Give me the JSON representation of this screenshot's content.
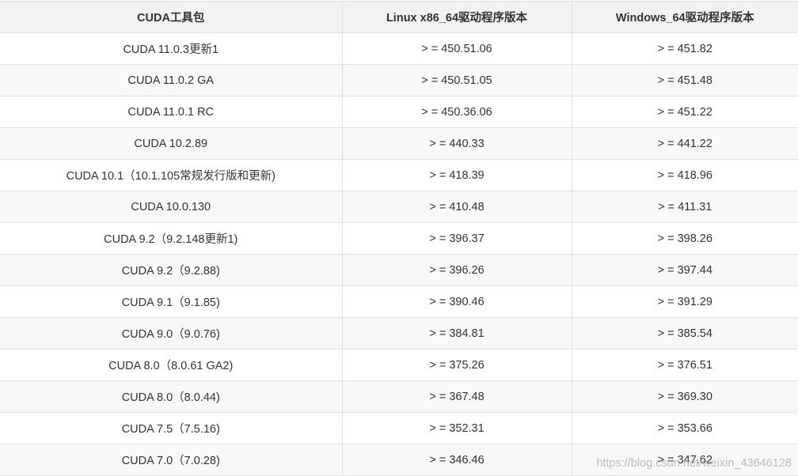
{
  "table": {
    "headers": [
      "CUDA工具包",
      "Linux x86_64驱动程序版本",
      "Windows_64驱动程序版本"
    ],
    "rows": [
      [
        "CUDA 11.0.3更新1",
        "> = 450.51.06",
        "> = 451.82"
      ],
      [
        "CUDA 11.0.2 GA",
        "> = 450.51.05",
        "> = 451.48"
      ],
      [
        "CUDA 11.0.1 RC",
        "> = 450.36.06",
        "> = 451.22"
      ],
      [
        "CUDA 10.2.89",
        "> = 440.33",
        "> = 441.22"
      ],
      [
        "CUDA 10.1（10.1.105常规发行版和更新)",
        "> = 418.39",
        "> = 418.96"
      ],
      [
        "CUDA 10.0.130",
        "> = 410.48",
        "> = 411.31"
      ],
      [
        "CUDA 9.2（9.2.148更新1)",
        "> = 396.37",
        "> = 398.26"
      ],
      [
        "CUDA 9.2（9.2.88)",
        "> = 396.26",
        "> = 397.44"
      ],
      [
        "CUDA 9.1（9.1.85)",
        "> = 390.46",
        "> = 391.29"
      ],
      [
        "CUDA 9.0（9.0.76)",
        "> = 384.81",
        "> = 385.54"
      ],
      [
        "CUDA 8.0（8.0.61 GA2)",
        "> = 375.26",
        "> = 376.51"
      ],
      [
        "CUDA 8.0（8.0.44)",
        "> = 367.48",
        "> = 369.30"
      ],
      [
        "CUDA 7.5（7.5.16)",
        "> = 352.31",
        "> = 353.66"
      ],
      [
        "CUDA 7.0（7.0.28)",
        "> = 346.46",
        "> = 347.62"
      ]
    ]
  },
  "watermark": "https://blog.csdn.net/weixin_43646128"
}
